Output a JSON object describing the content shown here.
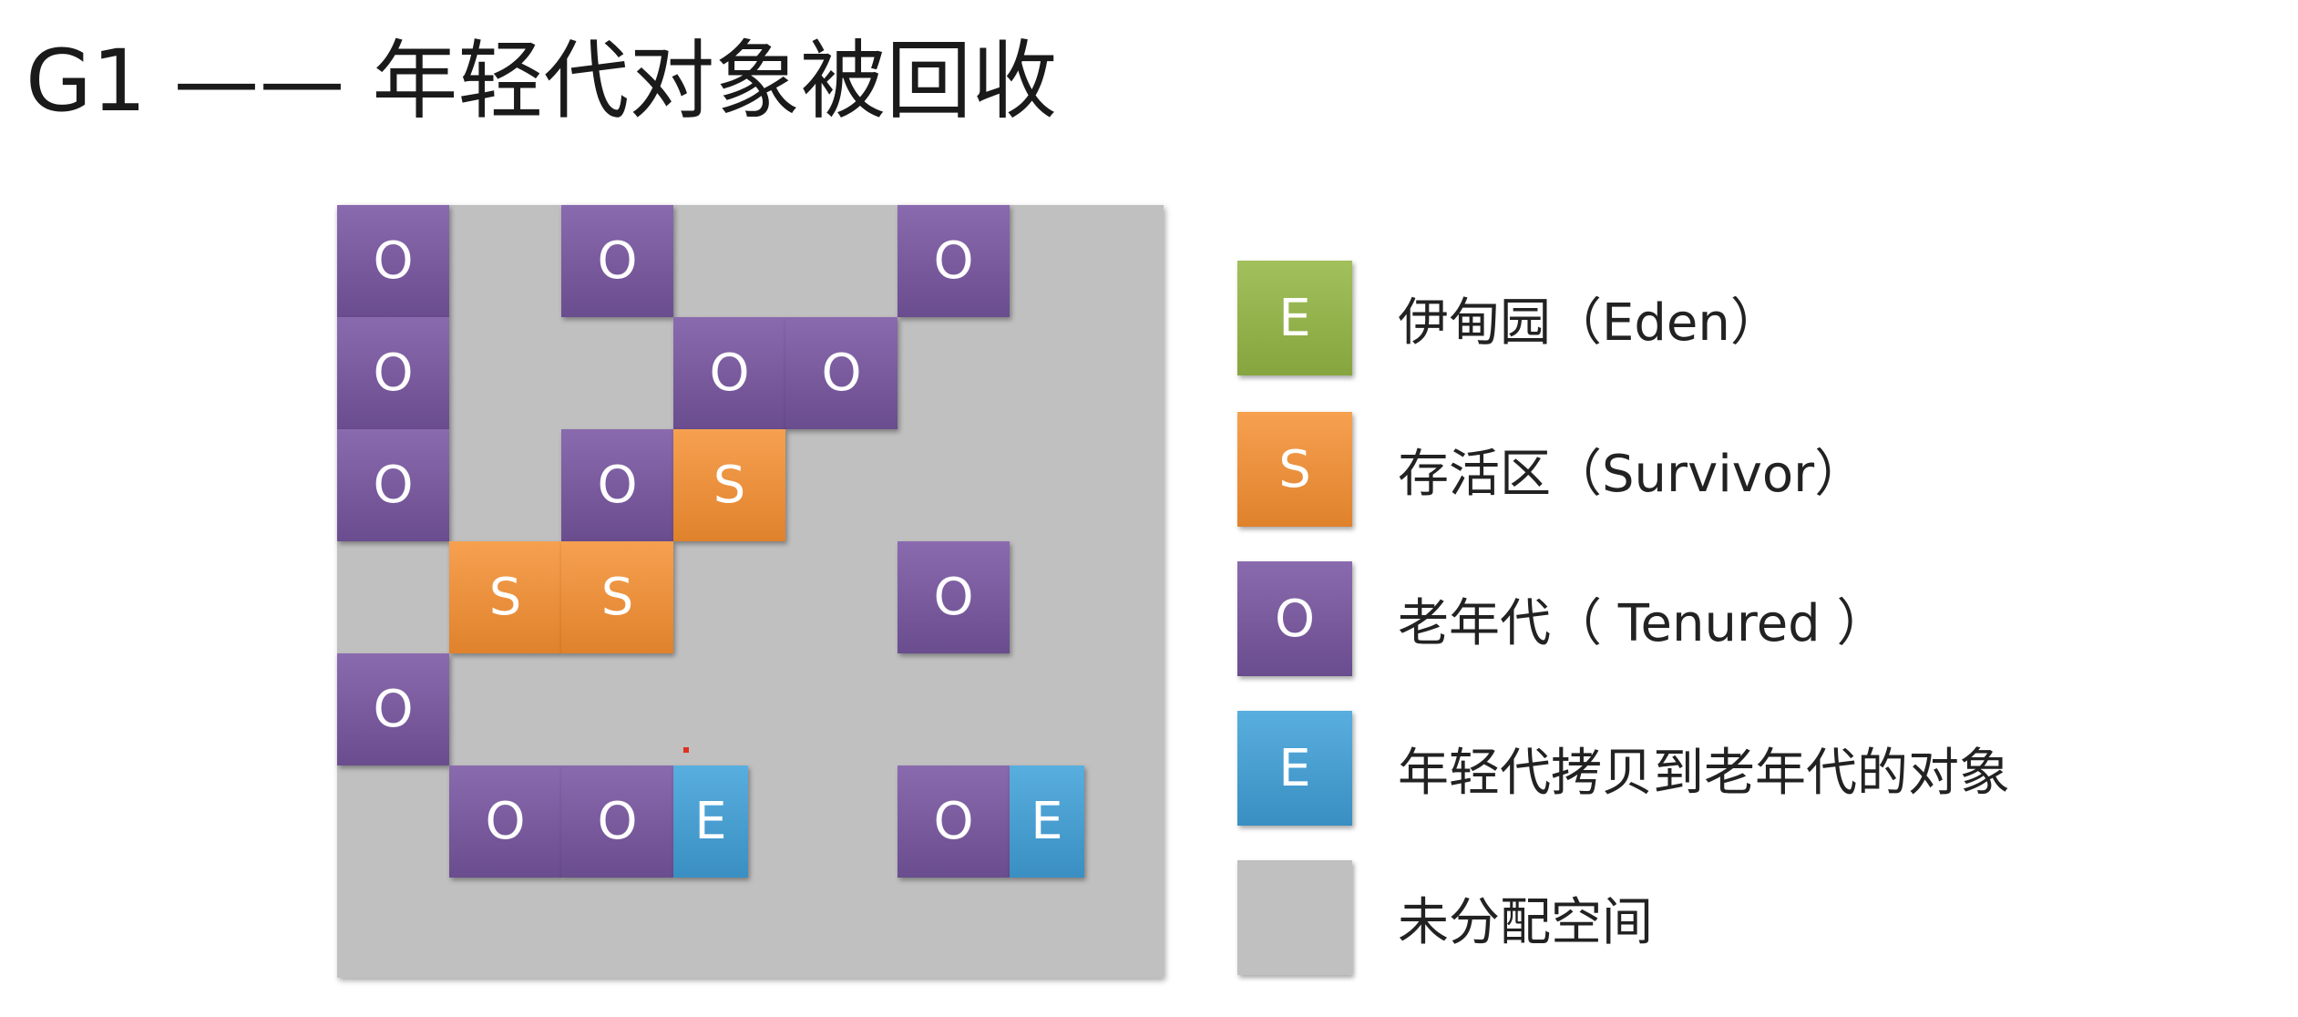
{
  "title": "G1 —— 年轻代对象被回收",
  "colors": {
    "eden": "#93b24d",
    "survivor": "#ec903c",
    "tenured": "#7a5c9e",
    "copied": "#4a9fd0",
    "unallocated": "#c0c0c0"
  },
  "grid": {
    "rows": 6,
    "cols": 7,
    "regions": [
      {
        "type": "O",
        "label": "O",
        "row": 0,
        "col": 0
      },
      {
        "type": "O",
        "label": "O",
        "row": 0,
        "col": 2
      },
      {
        "type": "O",
        "label": "O",
        "row": 0,
        "col": 5
      },
      {
        "type": "O",
        "label": "O",
        "row": 1,
        "col": 0
      },
      {
        "type": "O",
        "label": "O",
        "row": 1,
        "col": 3
      },
      {
        "type": "O",
        "label": "O",
        "row": 1,
        "col": 4
      },
      {
        "type": "O",
        "label": "O",
        "row": 2,
        "col": 0
      },
      {
        "type": "O",
        "label": "O",
        "row": 2,
        "col": 2
      },
      {
        "type": "S",
        "label": "S",
        "row": 2,
        "col": 3
      },
      {
        "type": "S",
        "label": "S",
        "row": 3,
        "col": 1
      },
      {
        "type": "S",
        "label": "S",
        "row": 3,
        "col": 2
      },
      {
        "type": "O",
        "label": "O",
        "row": 3,
        "col": 5
      },
      {
        "type": "O",
        "label": "O",
        "row": 4,
        "col": 0
      },
      {
        "type": "O",
        "label": "O",
        "row": 5,
        "col": 1
      },
      {
        "type": "O",
        "label": "O",
        "row": 5,
        "col": 2
      },
      {
        "type": "E",
        "label": "E",
        "row": 5,
        "col": 3,
        "half": true
      },
      {
        "type": "O",
        "label": "O",
        "row": 5,
        "col": 5
      },
      {
        "type": "E",
        "label": "E",
        "row": 5,
        "col": 6,
        "half": true
      }
    ]
  },
  "legend": [
    {
      "type": "G",
      "swatch": "E",
      "label": "伊甸园（Eden）"
    },
    {
      "type": "S",
      "swatch": "S",
      "label": "存活区（Survivor）"
    },
    {
      "type": "O",
      "swatch": "O",
      "label": "老年代（ Tenured ）"
    },
    {
      "type": "E",
      "swatch": "E",
      "label": "年轻代拷贝到老年代的对象"
    },
    {
      "type": "U",
      "swatch": "",
      "label": "未分配空间"
    }
  ]
}
